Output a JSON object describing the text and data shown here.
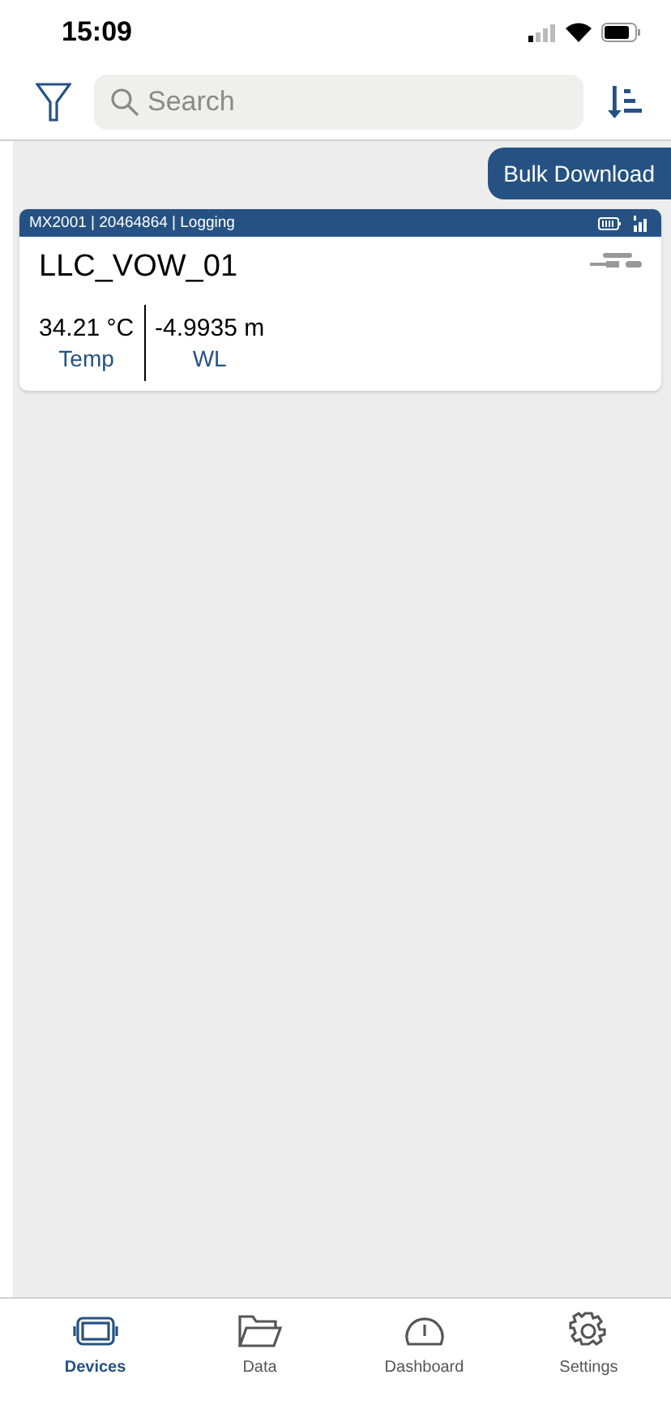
{
  "status_bar": {
    "time": "15:09"
  },
  "search": {
    "placeholder": "Search"
  },
  "bulk_button": "Bulk Download",
  "devices": [
    {
      "header": "MX2001 | 20464864 | Logging",
      "name": "LLC_VOW_01",
      "readings": [
        {
          "value": "34.21 °C",
          "label": "Temp"
        },
        {
          "value": "-4.9935 m",
          "label": "WL"
        }
      ]
    }
  ],
  "tabs": [
    {
      "label": "Devices",
      "kind": "devices",
      "selected": true
    },
    {
      "label": "Data",
      "kind": "data",
      "selected": false
    },
    {
      "label": "Dashboard",
      "kind": "dashboard",
      "selected": false
    },
    {
      "label": "Settings",
      "kind": "settings",
      "selected": false
    }
  ]
}
